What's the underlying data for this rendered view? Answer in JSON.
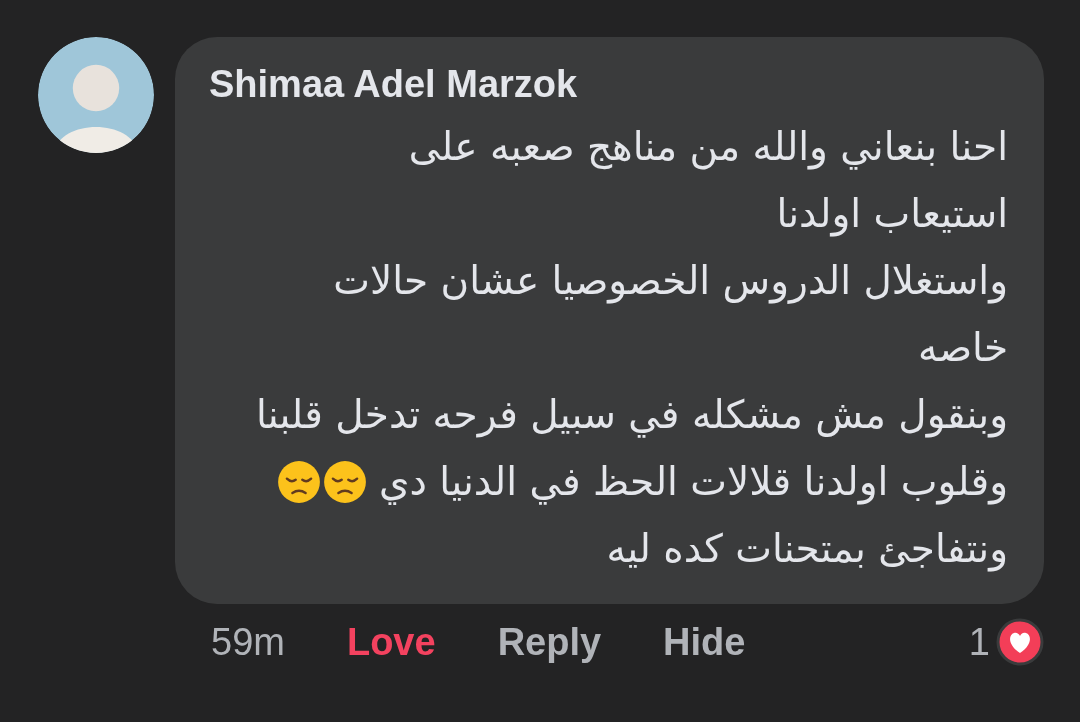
{
  "comment": {
    "author": "Shimaa Adel Marzok",
    "lines": [
      {
        "text": "احنا بنعاني والله من مناهج صعبه على"
      },
      {
        "text": "استيعاب اولدنا"
      },
      {
        "text": "واستغلال الدروس الخصوصيا عشان حالات"
      },
      {
        "text": "خاصه"
      },
      {
        "text": "وبنقول مش مشكله في سبيل فرحه تدخل قلبنا"
      },
      {
        "text": "وقلوب اولدنا قلالات الحظ في الدنيا دي",
        "emojis": [
          {
            "kind": "pensive"
          },
          {
            "kind": "pensive"
          }
        ]
      },
      {
        "text": "ونتفاجئ بمتحنات كده ليه"
      }
    ],
    "time": "59m",
    "love_link": {
      "label": "Love",
      "reacted": true
    },
    "reply_link": {
      "label": "Reply"
    },
    "hide_link": {
      "label": "Hide"
    },
    "reaction_count": "1",
    "reaction": {
      "kind": "love"
    }
  }
}
